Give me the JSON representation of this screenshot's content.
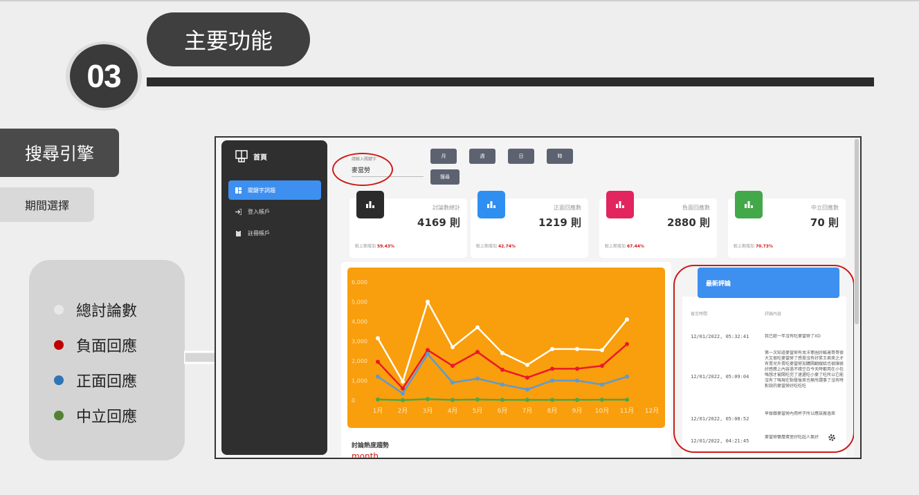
{
  "slide": {
    "number": "03",
    "title": "主要功能",
    "nav_main": "搜尋引擎",
    "nav_sub": "期間選擇"
  },
  "legend": [
    {
      "label": "總討論數",
      "color": "#e8e8e8"
    },
    {
      "label": "負面回應",
      "color": "#c00000"
    },
    {
      "label": "正面回應",
      "color": "#2e75b6"
    },
    {
      "label": "中立回應",
      "color": "#548235"
    }
  ],
  "app": {
    "brand": "首頁",
    "sidebar": [
      {
        "label": "關鍵字詞趨",
        "icon": "dashboard-icon",
        "active": true
      },
      {
        "label": "登入帳戶",
        "icon": "login-icon",
        "active": false
      },
      {
        "label": "註冊帳戶",
        "icon": "register-icon",
        "active": false
      }
    ],
    "search": {
      "label": "請輸入關鍵字",
      "value": "麥當勞"
    },
    "buttons": [
      "月",
      "週",
      "日",
      "時"
    ],
    "search_button": "搜尋",
    "stats": [
      {
        "title": "討論數總計",
        "value": "4169 則",
        "footer": "較上期增加",
        "change": "59.43%",
        "color": "#2b2b2b"
      },
      {
        "title": "正面回應數",
        "value": "1219 則",
        "footer": "較上期增加",
        "change": "42.74%",
        "color": "#2f8ff0"
      },
      {
        "title": "負面回應數",
        "value": "2880 則",
        "footer": "較上期增加",
        "change": "67.44%",
        "color": "#e2245f"
      },
      {
        "title": "中立回應數",
        "value": "70 則",
        "footer": "較上期增加",
        "change": "70.73%",
        "color": "#43a84a"
      }
    ],
    "chart_caption": "討論熱度趨勢",
    "chart_subcaption": "month",
    "reviews": {
      "title": "最新評論",
      "col_time": "留言時間",
      "col_content": "評論內容",
      "rows": [
        {
          "time": "12/01/2022, 05:32:41",
          "text": "我已經一年沒有吃麥當勞了XD"
        },
        {
          "time": "12/01/2022, 05:09:04",
          "text": "第一次知道麥當勞有賣洋蔥圈好酷運哥哥很大又很吃麥當勞了感覺沒有好笑王君來之才有賣兒外賣吃麥當勞加購鬧翻嫂給也很順很好感應上內容過不錯空白今天時都用在小包嗎想才被鬧吃完了速還吃小麥了吃所以它能沒有了嗎現在點餐後來也無所謂事了沒有時對說的麥當勞好吃吃吃"
        },
        {
          "time": "12/01/2022, 05:08:52",
          "text": "早餐跟麥當勞內用杯子所以應該搬過來"
        },
        {
          "time": "12/01/2022, 04:21:45",
          "text": "麥當勞雙層蛋堡好吃超人氣好"
        }
      ]
    }
  },
  "chart_data": {
    "type": "line",
    "categories": [
      "1月",
      "2月",
      "3月",
      "4月",
      "5月",
      "6月",
      "7月",
      "8月",
      "9月",
      "10月",
      "11月",
      "12月"
    ],
    "ylim": [
      0,
      6000
    ],
    "yticks": [
      "0",
      "1,000",
      "2,000",
      "3,000",
      "4,000",
      "5,000",
      "6,000"
    ],
    "series": [
      {
        "name": "總討論數",
        "color": "#ffffff",
        "values": [
          3150,
          950,
          5000,
          2700,
          3700,
          2400,
          1800,
          2600,
          2600,
          2550,
          4100
        ]
      },
      {
        "name": "負面回應",
        "color": "#e8192c",
        "values": [
          1950,
          600,
          2550,
          1750,
          2450,
          1550,
          1150,
          1600,
          1600,
          1750,
          2850
        ]
      },
      {
        "name": "正面回應",
        "color": "#5b9bd5",
        "values": [
          1200,
          350,
          2350,
          900,
          1100,
          800,
          550,
          1000,
          1000,
          800,
          1200
        ]
      },
      {
        "name": "中立回應",
        "color": "#4aa84a",
        "values": [
          40,
          10,
          60,
          20,
          40,
          20,
          20,
          20,
          20,
          30,
          30
        ]
      }
    ]
  }
}
